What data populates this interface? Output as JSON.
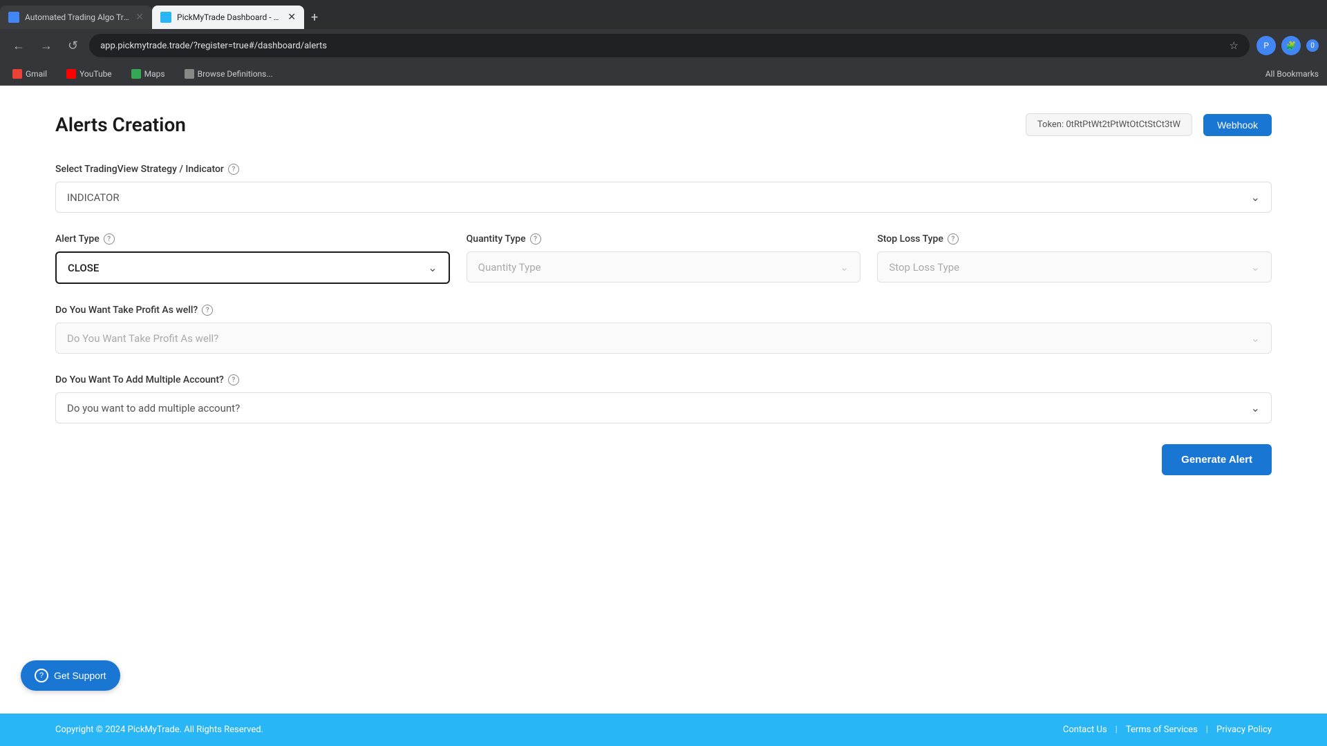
{
  "browser": {
    "tabs": [
      {
        "id": "tab1",
        "title": "Automated Trading Algo Tradi...",
        "favicon_color": "#4285f4",
        "active": false
      },
      {
        "id": "tab2",
        "title": "PickMyTrade Dashboard - Man...",
        "favicon_color": "#29b6f6",
        "active": true
      }
    ],
    "url": "app.pickmytrade.trade/?register=true#/dashboard/alerts",
    "new_tab_label": "+",
    "back_label": "←",
    "forward_label": "→",
    "reload_label": "↺",
    "bookmarks": [
      {
        "id": "gmail",
        "label": "Gmail",
        "favicon": "gmail"
      },
      {
        "id": "youtube",
        "label": "YouTube",
        "favicon": "youtube"
      },
      {
        "id": "maps",
        "label": "Maps",
        "favicon": "maps"
      },
      {
        "id": "browse",
        "label": "Browse Definitions...",
        "favicon": "generic"
      }
    ],
    "all_bookmarks_label": "All Bookmarks"
  },
  "page": {
    "title": "Alerts Creation",
    "token_label": "Token: 0tRtPtWt2tPtWtOtCtStCt3tW",
    "webhook_label": "Webhook"
  },
  "form": {
    "strategy_label": "Select TradingView Strategy / Indicator",
    "strategy_placeholder": "INDICATOR",
    "alert_type_label": "Alert Type",
    "alert_type_value": "CLOSE",
    "quantity_type_label": "Quantity Type",
    "quantity_type_placeholder": "Quantity Type",
    "stop_loss_type_label": "Stop Loss Type",
    "stop_loss_type_placeholder": "Stop Loss Type",
    "take_profit_label": "Do You Want Take Profit As well?",
    "take_profit_placeholder": "Do You Want Take Profit As well?",
    "multiple_account_label": "Do You Want To Add Multiple Account?",
    "multiple_account_placeholder": "Do you want to add multiple account?",
    "generate_button_label": "Generate Alert"
  },
  "support": {
    "button_label": "Get Support"
  },
  "footer": {
    "copyright": "Copyright © 2024 PickMyTrade. All Rights Reserved.",
    "contact_label": "Contact Us",
    "terms_label": "Terms of Services",
    "privacy_label": "Privacy Policy"
  }
}
